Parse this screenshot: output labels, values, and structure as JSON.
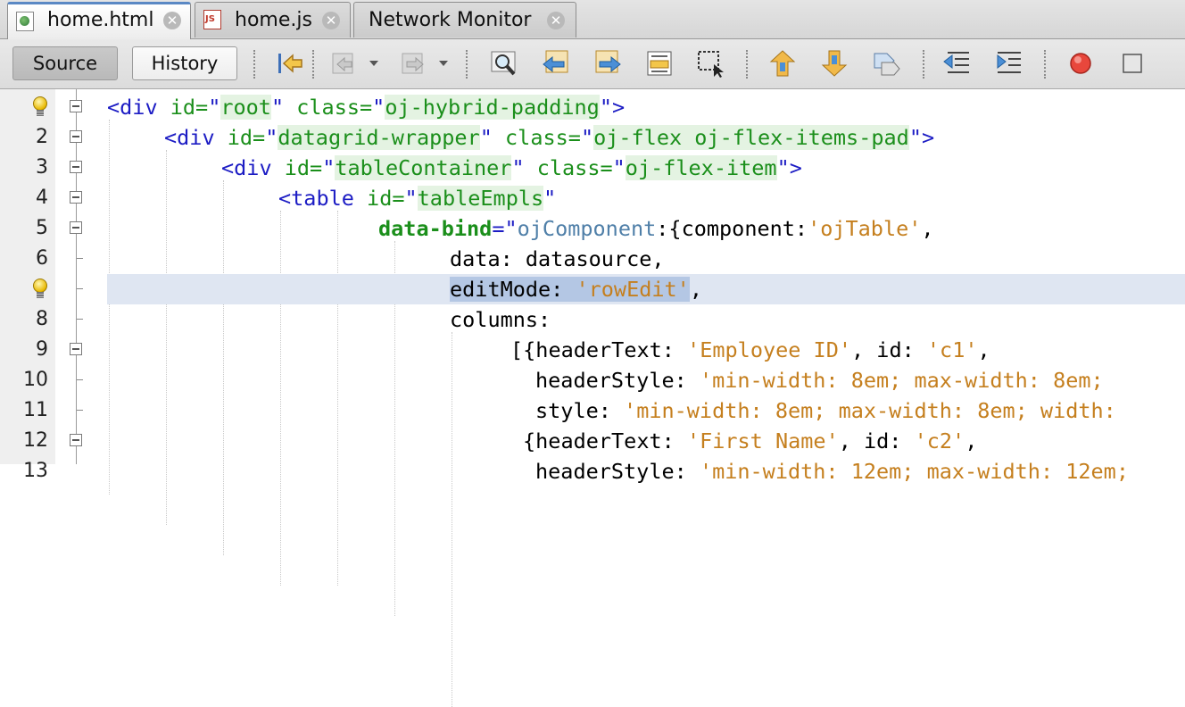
{
  "tabs": [
    {
      "label": "home.html",
      "icon": "html-file-icon",
      "active": true
    },
    {
      "label": "home.js",
      "icon": "js-file-icon",
      "active": false
    },
    {
      "label": "Network Monitor",
      "icon": "",
      "active": false
    }
  ],
  "toolbar": {
    "source_label": "Source",
    "history_label": "History",
    "icons": [
      "last-edit-icon",
      "back-icon",
      "forward-icon",
      "find-icon",
      "find-previous-icon",
      "find-next-icon",
      "toggle-highlight-icon",
      "toggle-rect-select-icon",
      "previous-bookmark-icon",
      "next-bookmark-icon",
      "toggle-bookmark-icon",
      "shift-left-icon",
      "shift-right-icon",
      "start-macro-icon",
      "stop-macro-icon"
    ]
  },
  "editor": {
    "line_numbers": [
      "",
      "2",
      "3",
      "4",
      "5",
      "6",
      "",
      "8",
      "9",
      "10",
      "11",
      "12",
      "13"
    ],
    "code": {
      "l1": {
        "open": "<div ",
        "a1": "id=",
        "q1": "\"",
        "v1": "root",
        "q1e": "\"",
        "a2": " class=",
        "q2": "\"",
        "v2": "oj-hybrid-padding",
        "q2e": "\"",
        "close": ">"
      },
      "l2": {
        "open": "<div ",
        "a1": "id=",
        "q1": "\"",
        "v1": "datagrid-wrapper",
        "q1e": "\"",
        "a2": " class=",
        "q2": "\"",
        "v2": "oj-flex oj-flex-items-pad",
        "q2e": "\"",
        "close": ">"
      },
      "l3": {
        "open": "<div ",
        "a1": "id=",
        "q1": "\"",
        "v1": "tableContainer",
        "q1e": "\"",
        "a2": " class=",
        "q2": "\"",
        "v2": "oj-flex-item",
        "q2e": "\"",
        "close": ">"
      },
      "l4": {
        "open": "<table ",
        "a1": "id=",
        "q1": "\"",
        "v1": "tableEmpls",
        "q1e": "\""
      },
      "l5": {
        "bind": "data-bind",
        "eq": "=\"",
        "oj": "ojComponent",
        "rest": ":{component:",
        "s1": "'ojTable'",
        "comma": ","
      },
      "l6": {
        "text": "data: datasource,"
      },
      "l7": {
        "key": "editMode: ",
        "s1": "'rowEdit'",
        "comma": ","
      },
      "l8": {
        "text": "columns:"
      },
      "l9": {
        "pre": "[{headerText: ",
        "s1": "'Employee ID'",
        "mid": ", id: ",
        "s2": "'c1'",
        "comma": ","
      },
      "l10": {
        "pre": "headerStyle: ",
        "s1": "'min-width: 8em; max-width: 8em;"
      },
      "l11": {
        "pre": "style: ",
        "s1": "'min-width: 8em; max-width: 8em; width:"
      },
      "l12": {
        "pre": "{headerText: ",
        "s1": "'First Name'",
        "mid": ", id: ",
        "s2": "'c2'",
        "comma": ","
      },
      "l13": {
        "pre": "headerStyle: ",
        "s1": "'min-width: 12em; max-width: 12em;"
      }
    }
  }
}
